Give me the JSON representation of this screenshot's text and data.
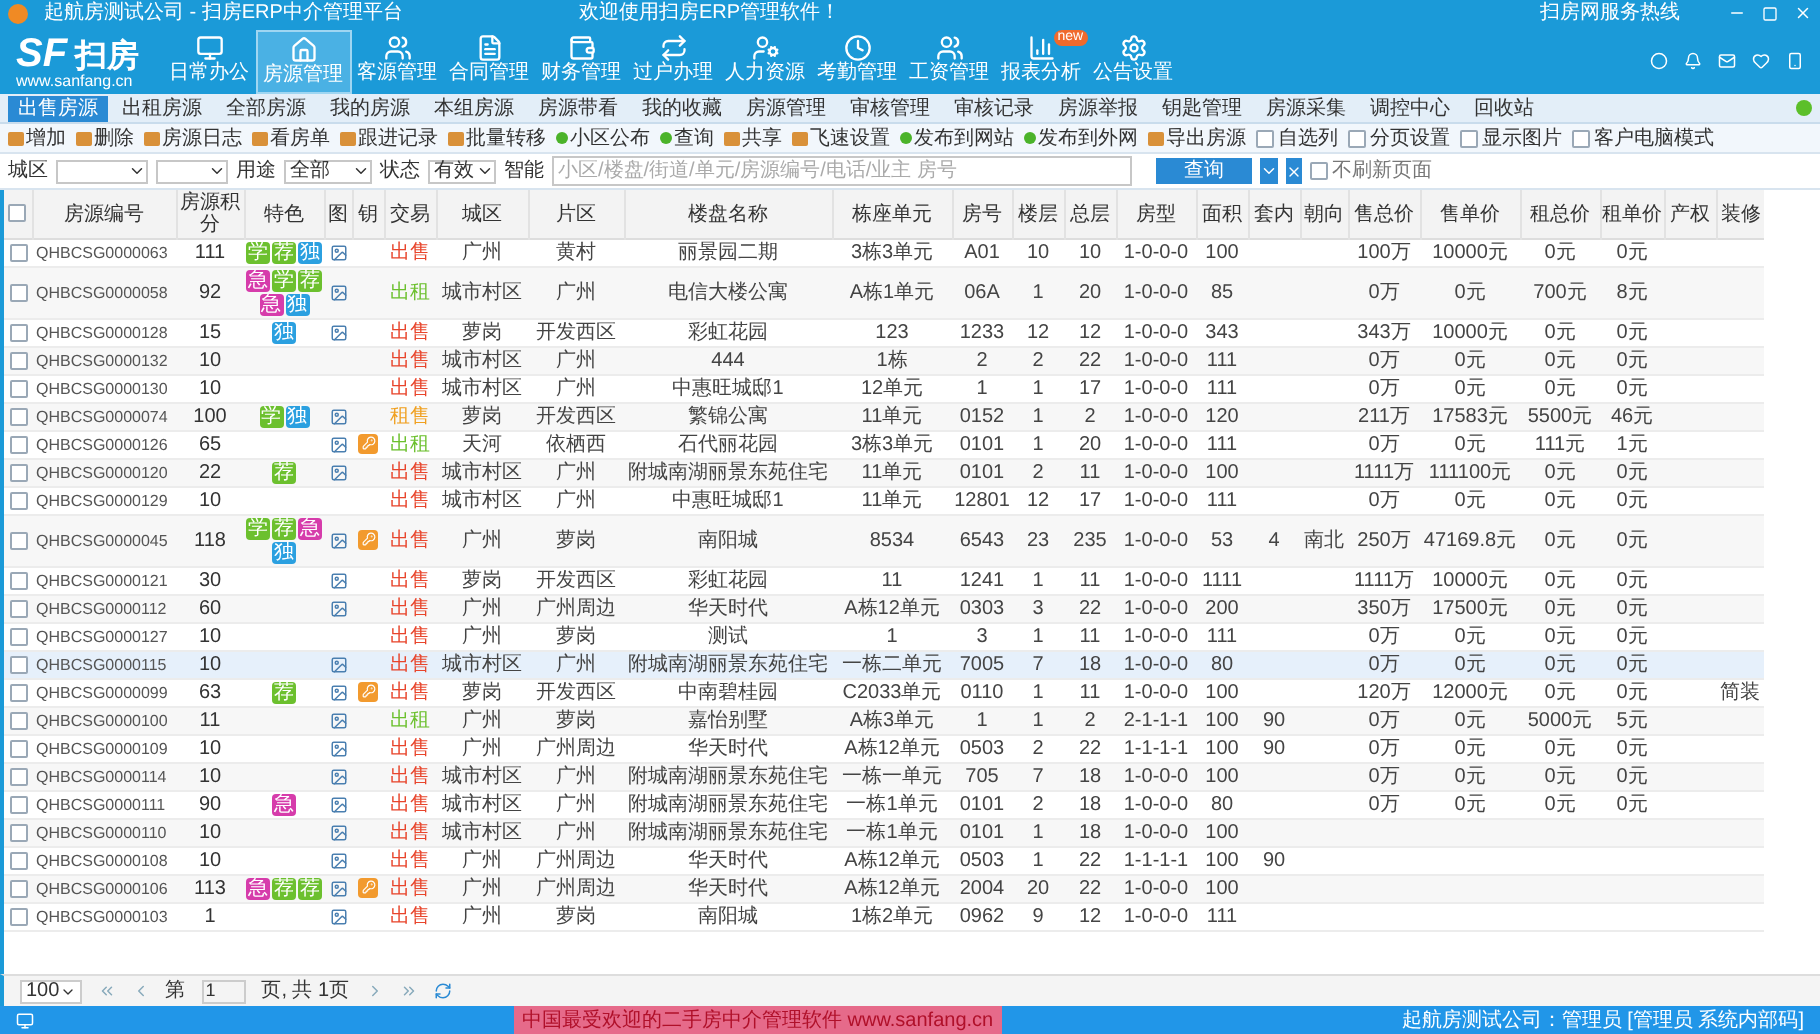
{
  "window": {
    "title": "起航房测试公司 - 扫房ERP中介管理平台",
    "welcome": "欢迎使用扫房ERP管理软件！",
    "hotline": "扫房网服务热线"
  },
  "logo": {
    "mark": "SF",
    "name": "扫房",
    "url": "www.sanfang.cn"
  },
  "nav": [
    {
      "label": "日常办公",
      "selected": false
    },
    {
      "label": "房源管理",
      "selected": true
    },
    {
      "label": "客源管理",
      "selected": false
    },
    {
      "label": "合同管理",
      "selected": false
    },
    {
      "label": "财务管理",
      "selected": false
    },
    {
      "label": "过户办理",
      "selected": false
    },
    {
      "label": "人力资源",
      "selected": false
    },
    {
      "label": "考勤管理",
      "selected": false
    },
    {
      "label": "工资管理",
      "selected": false
    },
    {
      "label": "报表分析",
      "selected": false,
      "badge": "new"
    },
    {
      "label": "公告设置",
      "selected": false
    }
  ],
  "tabs": [
    {
      "label": "出售房源",
      "selected": true
    },
    {
      "label": "出租房源",
      "selected": false
    },
    {
      "label": "全部房源",
      "selected": false
    },
    {
      "label": "我的房源",
      "selected": false
    },
    {
      "label": "本组房源",
      "selected": false
    },
    {
      "label": "房源带看",
      "selected": false
    },
    {
      "label": "我的收藏",
      "selected": false
    },
    {
      "label": "房源管理",
      "selected": false
    },
    {
      "label": "审核管理",
      "selected": false
    },
    {
      "label": "审核记录",
      "selected": false
    },
    {
      "label": "房源举报",
      "selected": false
    },
    {
      "label": "钥匙管理",
      "selected": false
    },
    {
      "label": "房源采集",
      "selected": false
    },
    {
      "label": "调控中心",
      "selected": false
    },
    {
      "label": "回收站",
      "selected": false
    }
  ],
  "toolbar": [
    {
      "label": "增加",
      "kind": "action"
    },
    {
      "label": "删除",
      "kind": "action"
    },
    {
      "label": "房源日志",
      "kind": "action"
    },
    {
      "label": "看房单",
      "kind": "action"
    },
    {
      "label": "跟进记录",
      "kind": "action"
    },
    {
      "label": "批量转移",
      "kind": "action"
    },
    {
      "label": "小区公布",
      "kind": "web"
    },
    {
      "label": "查询",
      "kind": "web"
    },
    {
      "label": "共享",
      "kind": "action"
    },
    {
      "label": "飞速设置",
      "kind": "action"
    },
    {
      "label": "发布到网站",
      "kind": "web"
    },
    {
      "label": "发布到外网",
      "kind": "web"
    },
    {
      "label": "导出房源",
      "kind": "action"
    },
    {
      "label": "自选列",
      "kind": "check",
      "checked": false
    },
    {
      "label": "分页设置",
      "kind": "check",
      "checked": false
    },
    {
      "label": "显示图片",
      "kind": "check",
      "checked": false
    },
    {
      "label": "客户电脑模式",
      "kind": "check",
      "checked": false
    }
  ],
  "filters": {
    "district_label": "城区",
    "use_label": "用途",
    "use_value": "全部",
    "status_label": "状态",
    "status_value": "有效",
    "smart_label": "智能",
    "placeholder": "小区/楼盘/街道/单元/房源编号/电话/业主 房号",
    "search": "查询",
    "no_refresh": {
      "label": "不刷新页面",
      "checked": false
    }
  },
  "table": {
    "columns": [
      "房源编号",
      "房源积分",
      "特色",
      "图",
      "钥",
      "交易",
      "城区",
      "片区",
      "楼盘名称",
      "栋座单元",
      "房号",
      "楼层",
      "总层",
      "房型",
      "面积",
      "套内",
      "朝向",
      "售总价",
      "售单价",
      "租总价",
      "租单价",
      "产权",
      "装修"
    ],
    "all_checked": false,
    "rows": [
      {
        "id": "QHBCSG0000063",
        "score": "111",
        "tags": [
          {
            "text": "学",
            "color": "#6cc02e"
          },
          {
            "text": "荐",
            "color": "#6cc02e"
          },
          {
            "text": "独",
            "color": "#2ba0e0"
          }
        ],
        "has_photo": true,
        "has_key": false,
        "trade": {
          "text": "出售",
          "color": "#e8452c"
        },
        "city": "广州",
        "area": "黄村",
        "estate": "丽景园二期",
        "unit": "3栋3单元",
        "room": "A01",
        "floor": "10",
        "total": "10",
        "type": "1-0-0-0",
        "size": "100",
        "sale_total": "100万",
        "sale_unit": "10000元",
        "rent_total": "0元",
        "rent_unit": "0元",
        "selected": false,
        "checked": false
      },
      {
        "id": "QHBCSG0000058",
        "score": "92",
        "tags": [
          {
            "text": "急",
            "color": "#d63cab"
          },
          {
            "text": "学",
            "color": "#6cc02e"
          },
          {
            "text": "荐",
            "color": "#6cc02e"
          },
          {
            "text": "急",
            "color": "#d63cab"
          },
          {
            "text": "独",
            "color": "#2ba0e0"
          }
        ],
        "has_photo": true,
        "has_key": false,
        "trade": {
          "text": "出租",
          "color": "#6cc02e"
        },
        "city": "城市村区",
        "area": "广州",
        "estate": "电信大楼公寓",
        "unit": "A栋1单元",
        "room": "06A",
        "floor": "1",
        "total": "20",
        "type": "1-0-0-0",
        "size": "85",
        "sale_total": "0万",
        "sale_unit": "0元",
        "rent_total": "700元",
        "rent_unit": "8元",
        "selected": false,
        "checked": false
      },
      {
        "id": "QHBCSG0000128",
        "score": "15",
        "tags": [
          {
            "text": "独",
            "color": "#2ba0e0"
          }
        ],
        "has_photo": true,
        "has_key": false,
        "trade": {
          "text": "出售",
          "color": "#e8452c"
        },
        "city": "萝岗",
        "area": "开发西区",
        "estate": "彩虹花园",
        "unit": "123",
        "room": "1233",
        "floor": "12",
        "total": "12",
        "type": "1-0-0-0",
        "size": "343",
        "sale_total": "343万",
        "sale_unit": "10000元",
        "rent_total": "0元",
        "rent_unit": "0元",
        "selected": false,
        "checked": false
      },
      {
        "id": "QHBCSG0000132",
        "score": "10",
        "tags": [],
        "has_photo": false,
        "has_key": false,
        "trade": {
          "text": "出售",
          "color": "#e8452c"
        },
        "city": "城市村区",
        "area": "广州",
        "estate": "444",
        "unit": "1栋",
        "room": "2",
        "floor": "2",
        "total": "22",
        "type": "1-0-0-0",
        "size": "111",
        "sale_total": "0万",
        "sale_unit": "0元",
        "rent_total": "0元",
        "rent_unit": "0元",
        "selected": false,
        "checked": false
      },
      {
        "id": "QHBCSG0000130",
        "score": "10",
        "tags": [],
        "has_photo": false,
        "has_key": false,
        "trade": {
          "text": "出售",
          "color": "#e8452c"
        },
        "city": "城市村区",
        "area": "广州",
        "estate": "中惠旺城邸1",
        "unit": "12单元",
        "room": "1",
        "floor": "1",
        "total": "17",
        "type": "1-0-0-0",
        "size": "111",
        "sale_total": "0万",
        "sale_unit": "0元",
        "rent_total": "0元",
        "rent_unit": "0元",
        "selected": false,
        "checked": false
      },
      {
        "id": "QHBCSG0000074",
        "score": "100",
        "tags": [
          {
            "text": "学",
            "color": "#6cc02e"
          },
          {
            "text": "独",
            "color": "#2ba0e0"
          }
        ],
        "has_photo": true,
        "has_key": false,
        "trade": {
          "text": "租售",
          "color": "#f0a020"
        },
        "city": "萝岗",
        "area": "开发西区",
        "estate": "繁锦公寓",
        "unit": "11单元",
        "room": "0152",
        "floor": "1",
        "total": "2",
        "type": "1-0-0-0",
        "size": "120",
        "sale_total": "211万",
        "sale_unit": "17583元",
        "rent_total": "5500元",
        "rent_unit": "46元",
        "selected": false,
        "checked": false
      },
      {
        "id": "QHBCSG0000126",
        "score": "65",
        "tags": [],
        "has_photo": true,
        "has_key": true,
        "trade": {
          "text": "出租",
          "color": "#6cc02e"
        },
        "city": "天河",
        "area": "依栖西",
        "estate": "石代丽花园",
        "unit": "3栋3单元",
        "room": "0101",
        "floor": "1",
        "total": "20",
        "type": "1-0-0-0",
        "size": "111",
        "sale_total": "0万",
        "sale_unit": "0元",
        "rent_total": "111元",
        "rent_unit": "1元",
        "selected": false,
        "checked": false
      },
      {
        "id": "QHBCSG0000120",
        "score": "22",
        "tags": [
          {
            "text": "荐",
            "color": "#6cc02e"
          }
        ],
        "has_photo": true,
        "has_key": false,
        "trade": {
          "text": "出售",
          "color": "#e8452c"
        },
        "city": "城市村区",
        "area": "广州",
        "estate": "附城南湖丽景东苑住宅",
        "unit": "11单元",
        "room": "0101",
        "floor": "2",
        "total": "11",
        "type": "1-0-0-0",
        "size": "100",
        "sale_total": "1111万",
        "sale_unit": "111100元",
        "rent_total": "0元",
        "rent_unit": "0元",
        "selected": false,
        "checked": false
      },
      {
        "id": "QHBCSG0000129",
        "score": "10",
        "tags": [],
        "has_photo": false,
        "has_key": false,
        "trade": {
          "text": "出售",
          "color": "#e8452c"
        },
        "city": "城市村区",
        "area": "广州",
        "estate": "中惠旺城邸1",
        "unit": "11单元",
        "room": "12801",
        "floor": "12",
        "total": "17",
        "type": "1-0-0-0",
        "size": "111",
        "sale_total": "0万",
        "sale_unit": "0元",
        "rent_total": "0元",
        "rent_unit": "0元",
        "selected": false,
        "checked": false
      },
      {
        "id": "QHBCSG0000045",
        "score": "118",
        "tags": [
          {
            "text": "学",
            "color": "#6cc02e"
          },
          {
            "text": "荐",
            "color": "#6cc02e"
          },
          {
            "text": "急",
            "color": "#d63cab"
          },
          {
            "text": "独",
            "color": "#2ba0e0"
          }
        ],
        "has_photo": true,
        "has_key": true,
        "trade": {
          "text": "出售",
          "color": "#e8452c"
        },
        "city": "广州",
        "area": "萝岗",
        "estate": "南阳城",
        "unit": "8534",
        "room": "6543",
        "floor": "23",
        "total": "235",
        "type": "1-0-0-0",
        "size": "53",
        "inner": "4",
        "direction": "南北",
        "sale_total": "250万",
        "sale_unit": "47169.8元",
        "rent_total": "0元",
        "rent_unit": "0元",
        "selected": false,
        "checked": false
      },
      {
        "id": "QHBCSG0000121",
        "score": "30",
        "tags": [],
        "has_photo": true,
        "has_key": false,
        "trade": {
          "text": "出售",
          "color": "#e8452c"
        },
        "city": "萝岗",
        "area": "开发西区",
        "estate": "彩虹花园",
        "unit": "11",
        "room": "1241",
        "floor": "1",
        "total": "11",
        "type": "1-0-0-0",
        "size": "1111",
        "sale_total": "1111万",
        "sale_unit": "10000元",
        "rent_total": "0元",
        "rent_unit": "0元",
        "selected": false,
        "checked": false
      },
      {
        "id": "QHBCSG0000112",
        "score": "60",
        "tags": [],
        "has_photo": true,
        "has_key": false,
        "trade": {
          "text": "出售",
          "color": "#e8452c"
        },
        "city": "广州",
        "area": "广州周边",
        "estate": "华天时代",
        "unit": "A栋12单元",
        "room": "0303",
        "floor": "3",
        "total": "22",
        "type": "1-0-0-0",
        "size": "200",
        "sale_total": "350万",
        "sale_unit": "17500元",
        "rent_total": "0元",
        "rent_unit": "0元",
        "selected": false,
        "checked": false
      },
      {
        "id": "QHBCSG0000127",
        "score": "10",
        "tags": [],
        "has_photo": false,
        "has_key": false,
        "trade": {
          "text": "出售",
          "color": "#e8452c"
        },
        "city": "广州",
        "area": "萝岗",
        "estate": "测试",
        "unit": "1",
        "room": "3",
        "floor": "1",
        "total": "11",
        "type": "1-0-0-0",
        "size": "111",
        "sale_total": "0万",
        "sale_unit": "0元",
        "rent_total": "0元",
        "rent_unit": "0元",
        "selected": false,
        "checked": false
      },
      {
        "id": "QHBCSG0000115",
        "score": "10",
        "tags": [],
        "has_photo": true,
        "has_key": false,
        "trade": {
          "text": "出售",
          "color": "#e8452c"
        },
        "city": "城市村区",
        "area": "广州",
        "estate": "附城南湖丽景东苑住宅",
        "unit": "一栋二单元",
        "room": "7005",
        "floor": "7",
        "total": "18",
        "type": "1-0-0-0",
        "size": "80",
        "sale_total": "0万",
        "sale_unit": "0元",
        "rent_total": "0元",
        "rent_unit": "0元",
        "selected": true,
        "checked": false
      },
      {
        "id": "QHBCSG0000099",
        "score": "63",
        "tags": [
          {
            "text": "荐",
            "color": "#6cc02e"
          }
        ],
        "has_photo": true,
        "has_key": true,
        "trade": {
          "text": "出售",
          "color": "#e8452c"
        },
        "city": "萝岗",
        "area": "开发西区",
        "estate": "中南碧桂园",
        "unit": "C2033单元",
        "room": "0110",
        "floor": "1",
        "total": "11",
        "type": "1-0-0-0",
        "size": "100",
        "sale_total": "120万",
        "sale_unit": "12000元",
        "rent_total": "0元",
        "rent_unit": "0元",
        "decoration": "简装",
        "selected": false,
        "checked": false
      },
      {
        "id": "QHBCSG0000100",
        "score": "11",
        "tags": [],
        "has_photo": true,
        "has_key": false,
        "trade": {
          "text": "出租",
          "color": "#6cc02e"
        },
        "city": "广州",
        "area": "萝岗",
        "estate": "嘉怡别墅",
        "unit": "A栋3单元",
        "room": "1",
        "floor": "1",
        "total": "2",
        "type": "2-1-1-1",
        "size": "100",
        "inner": "90",
        "sale_total": "0万",
        "sale_unit": "0元",
        "rent_total": "5000元",
        "rent_unit": "5元",
        "selected": false,
        "checked": false
      },
      {
        "id": "QHBCSG0000109",
        "score": "10",
        "tags": [],
        "has_photo": true,
        "has_key": false,
        "trade": {
          "text": "出售",
          "color": "#e8452c"
        },
        "city": "广州",
        "area": "广州周边",
        "estate": "华天时代",
        "unit": "A栋12单元",
        "room": "0503",
        "floor": "2",
        "total": "22",
        "type": "1-1-1-1",
        "size": "100",
        "inner": "90",
        "sale_total": "0万",
        "sale_unit": "0元",
        "rent_total": "0元",
        "rent_unit": "0元",
        "selected": false,
        "checked": false
      },
      {
        "id": "QHBCSG0000114",
        "score": "10",
        "tags": [],
        "has_photo": true,
        "has_key": false,
        "trade": {
          "text": "出售",
          "color": "#e8452c"
        },
        "city": "城市村区",
        "area": "广州",
        "estate": "附城南湖丽景东苑住宅",
        "unit": "一栋一单元",
        "room": "705",
        "floor": "7",
        "total": "18",
        "type": "1-0-0-0",
        "size": "100",
        "sale_total": "0万",
        "sale_unit": "0元",
        "rent_total": "0元",
        "rent_unit": "0元",
        "selected": false,
        "checked": false
      },
      {
        "id": "QHBCSG0000111",
        "score": "90",
        "tags": [
          {
            "text": "急",
            "color": "#d63cab"
          }
        ],
        "has_photo": true,
        "has_key": false,
        "trade": {
          "text": "出售",
          "color": "#e8452c"
        },
        "city": "城市村区",
        "area": "广州",
        "estate": "附城南湖丽景东苑住宅",
        "unit": "一栋1单元",
        "room": "0101",
        "floor": "2",
        "total": "18",
        "type": "1-0-0-0",
        "size": "80",
        "sale_total": "0万",
        "sale_unit": "0元",
        "rent_total": "0元",
        "rent_unit": "0元",
        "selected": false,
        "checked": false
      },
      {
        "id": "QHBCSG0000110",
        "score": "10",
        "tags": [],
        "has_photo": true,
        "has_key": false,
        "trade": {
          "text": "出售",
          "color": "#e8452c"
        },
        "city": "城市村区",
        "area": "广州",
        "estate": "附城南湖丽景东苑住宅",
        "unit": "一栋1单元",
        "room": "0101",
        "floor": "1",
        "total": "18",
        "type": "1-0-0-0",
        "size": "100",
        "selected": false,
        "checked": false
      },
      {
        "id": "QHBCSG0000108",
        "score": "10",
        "tags": [],
        "has_photo": true,
        "has_key": false,
        "trade": {
          "text": "出售",
          "color": "#e8452c"
        },
        "city": "广州",
        "area": "广州周边",
        "estate": "华天时代",
        "unit": "A栋12单元",
        "room": "0503",
        "floor": "1",
        "total": "22",
        "type": "1-1-1-1",
        "size": "100",
        "inner": "90",
        "selected": false,
        "checked": false
      },
      {
        "id": "QHBCSG0000106",
        "score": "113",
        "tags": [
          {
            "text": "急",
            "color": "#d63cab"
          },
          {
            "text": "荐",
            "color": "#6cc02e"
          },
          {
            "text": "荐",
            "color": "#6cc02e"
          }
        ],
        "has_photo": true,
        "has_key": true,
        "trade": {
          "text": "出售",
          "color": "#e8452c"
        },
        "city": "广州",
        "area": "广州周边",
        "estate": "华天时代",
        "unit": "A栋12单元",
        "room": "2004",
        "floor": "20",
        "total": "22",
        "type": "1-0-0-0",
        "size": "100",
        "selected": false,
        "checked": false
      },
      {
        "id": "QHBCSG0000103",
        "score": "1",
        "tags": [],
        "has_photo": true,
        "has_key": false,
        "trade": {
          "text": "出售",
          "color": "#e8452c"
        },
        "city": "广州",
        "area": "萝岗",
        "estate": "南阳城",
        "unit": "1栋2单元",
        "room": "0962",
        "floor": "9",
        "total": "12",
        "type": "1-0-0-0",
        "size": "111",
        "selected": false,
        "checked": false
      }
    ]
  },
  "pager": {
    "page_size": "100",
    "page_prefix": "第",
    "page": "1",
    "page_suffix": "页, 共 1页"
  },
  "status_bar": {
    "notice": "中国最受欢迎的二手房中介管理软件 www.sanfang.cn",
    "user": "起航房测试公司：管理员 [管理员 系统内部码]"
  }
}
